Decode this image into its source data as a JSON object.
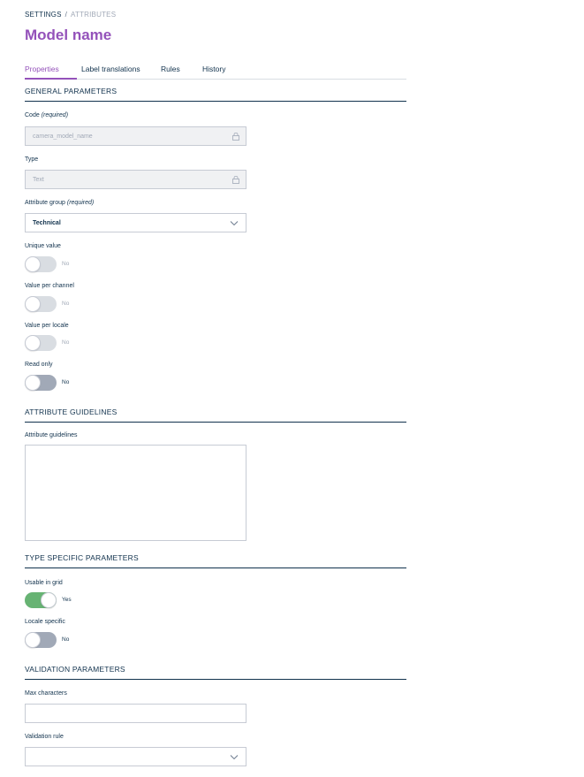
{
  "breadcrumb": {
    "root": "Settings",
    "separator": "/",
    "current": "Attributes"
  },
  "title": "Model name",
  "tabs": [
    {
      "label": "Properties",
      "active": true
    },
    {
      "label": "Label translations",
      "active": false
    },
    {
      "label": "Rules",
      "active": false
    },
    {
      "label": "History",
      "active": false
    }
  ],
  "sections": {
    "general": "General parameters",
    "guidelines": "Attribute guidelines",
    "type_specific": "Type specific parameters",
    "validation": "Validation parameters"
  },
  "fields": {
    "code": {
      "label": "Code",
      "required": "(required)",
      "value": "camera_model_name",
      "icon": "lock-icon"
    },
    "type": {
      "label": "Type",
      "value": "Text",
      "icon": "lock-icon"
    },
    "group": {
      "label": "Attribute group",
      "required": "(required)",
      "value": "Technical",
      "icon": "chevron-down-icon"
    },
    "unique": {
      "label": "Unique value",
      "state": "No",
      "on": false,
      "disabled": true
    },
    "per_channel": {
      "label": "Value per channel",
      "state": "No",
      "on": false,
      "disabled": true
    },
    "per_locale": {
      "label": "Value per locale",
      "state": "No",
      "on": false,
      "disabled": true
    },
    "read_only": {
      "label": "Read only",
      "state": "No",
      "on": false,
      "disabled": false
    },
    "guidelines": {
      "label": "Attribute guidelines",
      "value": ""
    },
    "usable_in_grid": {
      "label": "Usable in grid",
      "state": "Yes",
      "on": true,
      "disabled": false
    },
    "locale_specific": {
      "label": "Locale specific",
      "state": "No",
      "on": false,
      "disabled": false
    },
    "max_characters": {
      "label": "Max characters",
      "value": ""
    },
    "validation_rule": {
      "label": "Validation rule",
      "value": "",
      "icon": "chevron-down-icon"
    }
  },
  "colors": {
    "brand": "#9452ba",
    "text": "#11324d",
    "toggle_on": "#67b373",
    "toggle_off": "#a1a9b7",
    "toggle_disabled": "#d9dde2",
    "border": "#c7cbd4"
  }
}
